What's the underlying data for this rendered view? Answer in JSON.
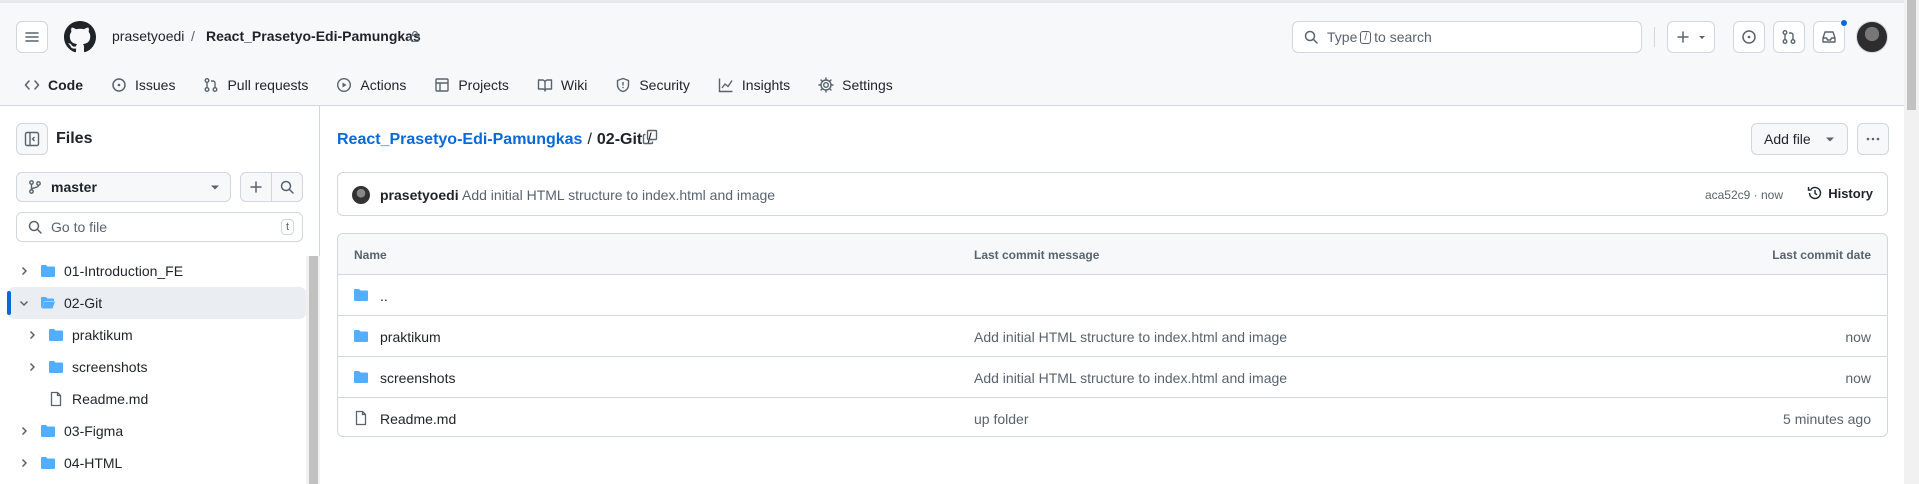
{
  "header": {
    "owner": "prasetyoedi",
    "separator": "/",
    "repo": "React_Prasetyo-Edi-Pamungkas",
    "search_prefix": "Type",
    "search_key": "/",
    "search_suffix": "to search",
    "tabs": [
      {
        "label": "Code",
        "icon": "code-icon"
      },
      {
        "label": "Issues",
        "icon": "issue-icon"
      },
      {
        "label": "Pull requests",
        "icon": "pull-request-icon"
      },
      {
        "label": "Actions",
        "icon": "play-icon"
      },
      {
        "label": "Projects",
        "icon": "table-icon"
      },
      {
        "label": "Wiki",
        "icon": "book-icon"
      },
      {
        "label": "Security",
        "icon": "shield-icon"
      },
      {
        "label": "Insights",
        "icon": "graph-icon"
      },
      {
        "label": "Settings",
        "icon": "gear-icon"
      }
    ]
  },
  "sidebar": {
    "title": "Files",
    "branch": "master",
    "goto_placeholder": "Go to file",
    "goto_key": "t",
    "tree": [
      {
        "label": "01-Introduction_FE",
        "type": "folder",
        "depth": 0,
        "expanded": false
      },
      {
        "label": "02-Git",
        "type": "folder",
        "depth": 0,
        "expanded": true,
        "selected": true
      },
      {
        "label": "praktikum",
        "type": "folder",
        "depth": 1,
        "expanded": false
      },
      {
        "label": "screenshots",
        "type": "folder",
        "depth": 1,
        "expanded": false
      },
      {
        "label": "Readme.md",
        "type": "file",
        "depth": 1
      },
      {
        "label": "03-Figma",
        "type": "folder",
        "depth": 0,
        "expanded": false
      },
      {
        "label": "04-HTML",
        "type": "folder",
        "depth": 0,
        "expanded": false
      }
    ]
  },
  "main": {
    "repo_link": "React_Prasetyo-Edi-Pamungkas",
    "folder": "02-Git",
    "sep": "/",
    "add_file": "Add file",
    "commit": {
      "user": "prasetyoedi",
      "message": "Add initial HTML structure to index.html and image",
      "hash_time": "aca52c9 · now",
      "history": "History"
    },
    "columns": {
      "name": "Name",
      "message": "Last commit message",
      "date": "Last commit date"
    },
    "rows": [
      {
        "name": "..",
        "type": "folder",
        "message": "",
        "date": ""
      },
      {
        "name": "praktikum",
        "type": "folder",
        "message": "Add initial HTML structure to index.html and image",
        "date": "now"
      },
      {
        "name": "screenshots",
        "type": "folder",
        "message": "Add initial HTML structure to index.html and image",
        "date": "now"
      },
      {
        "name": "Readme.md",
        "type": "file",
        "message": "up folder",
        "date": "5 minutes ago"
      }
    ]
  },
  "colors": {
    "accent": "#0969da",
    "folder": "#54aeff",
    "tab_underline": "#fd8c73",
    "notification": "#0969da"
  }
}
